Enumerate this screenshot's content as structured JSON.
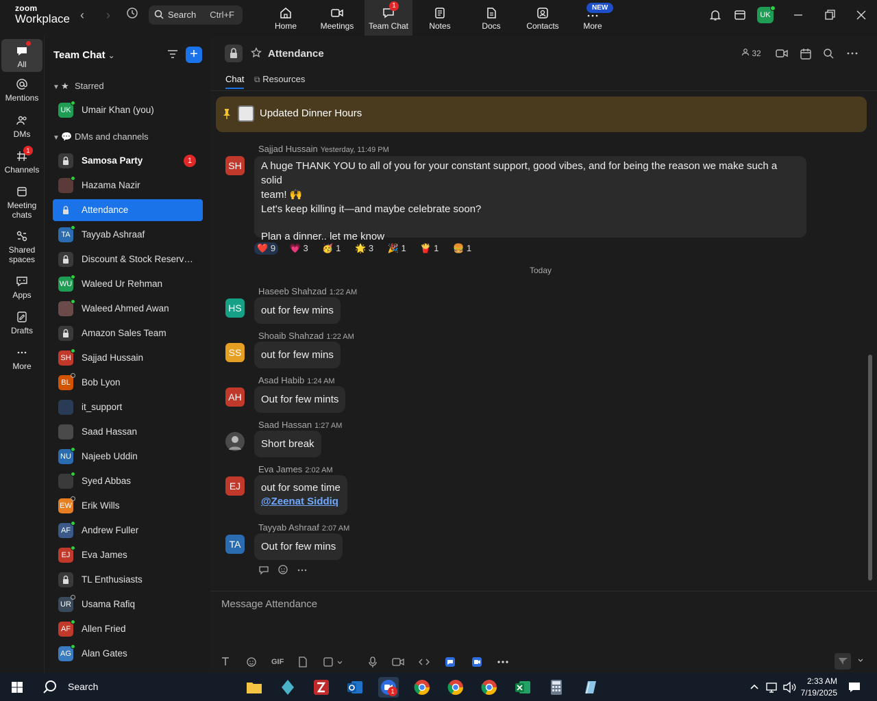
{
  "app": {
    "brand_top": "zoom",
    "brand_bottom": "Workplace"
  },
  "search": {
    "label": "Search",
    "shortcut": "Ctrl+F"
  },
  "top_nav": [
    {
      "label": "Home"
    },
    {
      "label": "Meetings"
    },
    {
      "label": "Team Chat",
      "badge": "1"
    },
    {
      "label": "Notes"
    },
    {
      "label": "Docs"
    },
    {
      "label": "Contacts"
    },
    {
      "label": "More",
      "badge": "NEW"
    }
  ],
  "user": {
    "initials": "UK"
  },
  "rail": [
    {
      "label": "All"
    },
    {
      "label": "Mentions"
    },
    {
      "label": "DMs"
    },
    {
      "label": "Channels",
      "badge": "1"
    },
    {
      "label": "Meeting chats"
    },
    {
      "label": "Shared spaces"
    },
    {
      "label": "Apps"
    },
    {
      "label": "Drafts"
    },
    {
      "label": "More"
    }
  ],
  "sidebar": {
    "title": "Team Chat",
    "starred_header": "Starred",
    "dm_header": "DMs and channels",
    "starred": [
      {
        "name": "Umair Khan (you)",
        "initials": "UK",
        "color": "#1f9d55"
      }
    ],
    "items": [
      {
        "name": "Samosa Party",
        "type": "channel",
        "badge": "1"
      },
      {
        "name": "Hazama Nazir",
        "initials": "",
        "color": "#5b3a3a"
      },
      {
        "name": "Attendance",
        "type": "channel"
      },
      {
        "name": "Tayyab Ashraaf",
        "initials": "TA",
        "color": "#2b6cb0"
      },
      {
        "name": "Discount & Stock Reservati...",
        "type": "channel"
      },
      {
        "name": "Waleed Ur Rehman",
        "initials": "WU",
        "color": "#1f9d55"
      },
      {
        "name": "Waleed Ahmed Awan",
        "initials": "",
        "color": "#6b4a4a"
      },
      {
        "name": "Amazon Sales Team",
        "type": "channel"
      },
      {
        "name": "Sajjad Hussain",
        "initials": "SH",
        "color": "#c0392b"
      },
      {
        "name": "Bob Lyon",
        "initials": "BL",
        "color": "#d35400"
      },
      {
        "name": "it_support",
        "initials": "",
        "color": "#2a3b55"
      },
      {
        "name": "Saad Hassan",
        "initials": "",
        "color": "#4a4a4a"
      },
      {
        "name": "Najeeb Uddin",
        "initials": "NU",
        "color": "#2b6cb0"
      },
      {
        "name": "Syed Abbas",
        "initials": "",
        "color": "#3a3a3a"
      },
      {
        "name": "Erik Wills",
        "initials": "EW",
        "color": "#e67e22"
      },
      {
        "name": "Andrew Fuller",
        "initials": "AF",
        "color": "#3b5a8a"
      },
      {
        "name": "Eva James",
        "initials": "EJ",
        "color": "#c0392b"
      },
      {
        "name": "TL Enthusiasts",
        "type": "channel"
      },
      {
        "name": "Usama Rafiq",
        "initials": "UR",
        "color": "#3b4a5a"
      },
      {
        "name": "Allen Fried",
        "initials": "AF",
        "color": "#c0392b"
      },
      {
        "name": "Alan Gates",
        "initials": "AG",
        "color": "#3b7bbf"
      }
    ]
  },
  "channel": {
    "name": "Attendance",
    "members": "32",
    "tabs": [
      "Chat",
      "Resources"
    ],
    "pinned": "Updated Dinner Hours",
    "day_separator": "Today",
    "composer_placeholder": "Message Attendance"
  },
  "messages": [
    {
      "initials": "SH",
      "sender": "Sajjad Hussain",
      "time": "Yesterday, 11:49 PM",
      "color": "#c0392b",
      "lines": [
        "A huge THANK YOU to all of you for your constant support, good vibes, and for being the reason we make such a solid",
        "team! 🙌",
        "Let's keep killing it—and maybe celebrate soon?",
        "",
        "Plan a dinner.. let me know"
      ]
    },
    {
      "initials": "HS",
      "sender": "Haseeb Shahzad",
      "time": "1:22 AM",
      "color": "#16a085",
      "text": "out for few mins"
    },
    {
      "initials": "SS",
      "sender": "Shoaib Shahzad",
      "time": "1:22 AM",
      "color": "#e5a023",
      "text": "out for few mins"
    },
    {
      "initials": "AH",
      "sender": "Asad Habib",
      "time": "1:24 AM",
      "color": "#c0392b",
      "text": "Out for few mints"
    },
    {
      "initials": "",
      "sender": "Saad Hassan",
      "time": "1:27 AM",
      "color": "#4a4a4a",
      "text": "Short break"
    },
    {
      "initials": "EJ",
      "sender": "Eva James",
      "time": "2:02 AM",
      "color": "#c0392b",
      "text": "out for some time",
      "mention": "@Zeenat Siddiq"
    },
    {
      "initials": "TA",
      "sender": "Tayyab Ashraaf",
      "time": "2:07 AM",
      "color": "#2b6cb0",
      "text": "Out for few mins"
    }
  ],
  "reactions": [
    {
      "emoji": "❤️",
      "count": "9",
      "mine": true
    },
    {
      "emoji": "💗",
      "count": "3"
    },
    {
      "emoji": "🥳",
      "count": "1"
    },
    {
      "emoji": "🌟",
      "count": "3"
    },
    {
      "emoji": "🎉",
      "count": "1"
    },
    {
      "emoji": "🍟",
      "count": "1"
    },
    {
      "emoji": "🍔",
      "count": "1"
    }
  ],
  "composer_tools": {
    "gif": "GIF"
  },
  "taskbar": {
    "search": "Search",
    "time": "2:33 AM",
    "date": "7/19/2025",
    "zoom_badge": "1"
  }
}
